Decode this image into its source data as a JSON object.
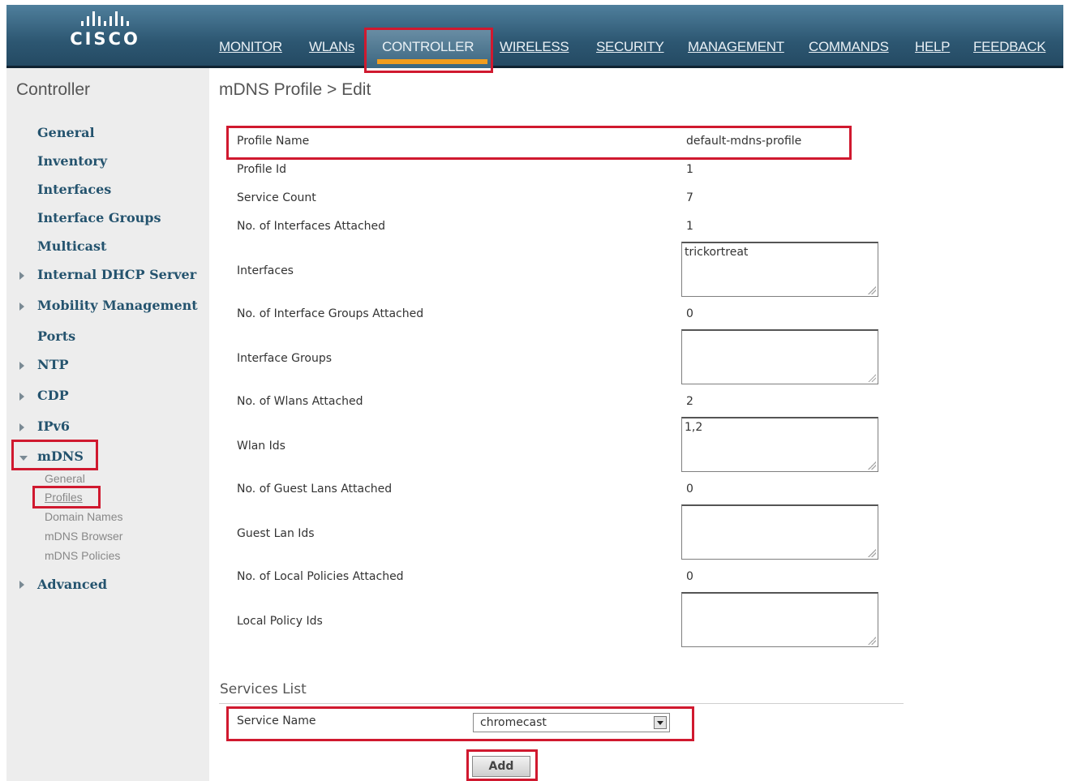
{
  "brand": {
    "logo_text": "CISCO"
  },
  "nav": {
    "items": [
      "MONITOR",
      "WLANs",
      "CONTROLLER",
      "WIRELESS",
      "SECURITY",
      "MANAGEMENT",
      "COMMANDS",
      "HELP",
      "FEEDBACK"
    ],
    "active": "CONTROLLER"
  },
  "sidebar": {
    "title": "Controller",
    "items": [
      {
        "label": "General"
      },
      {
        "label": "Inventory"
      },
      {
        "label": "Interfaces"
      },
      {
        "label": "Interface Groups"
      },
      {
        "label": "Multicast"
      },
      {
        "label": "Internal DHCP Server",
        "expandable": true
      },
      {
        "label": "Mobility Management",
        "expandable": true
      },
      {
        "label": "Ports"
      },
      {
        "label": "NTP",
        "expandable": true
      },
      {
        "label": "CDP",
        "expandable": true
      },
      {
        "label": "IPv6",
        "expandable": true
      },
      {
        "label": "mDNS",
        "expandable": true,
        "expanded": true
      },
      {
        "label": "Advanced",
        "expandable": true
      }
    ],
    "mdns_sub": [
      "General",
      "Profiles",
      "Domain Names",
      "mDNS Browser",
      "mDNS Policies"
    ],
    "mdns_selected": "Profiles"
  },
  "main": {
    "title": "mDNS Profile > Edit",
    "fields": [
      {
        "label": "Profile Name",
        "value": "default-mdns-profile"
      },
      {
        "label": "Profile Id",
        "value": "1"
      },
      {
        "label": "Service Count",
        "value": "7"
      },
      {
        "label": "No. of Interfaces Attached",
        "value": "1"
      },
      {
        "label": "Interfaces",
        "value": "trickortreat"
      },
      {
        "label": "No. of Interface Groups Attached",
        "value": "0"
      },
      {
        "label": "Interface Groups",
        "value": ""
      },
      {
        "label": "No. of Wlans Attached",
        "value": "2"
      },
      {
        "label": "Wlan Ids",
        "value": "1,2"
      },
      {
        "label": "No. of Guest Lans Attached",
        "value": "0"
      },
      {
        "label": "Guest Lan Ids",
        "value": ""
      },
      {
        "label": "No. of Local Policies Attached",
        "value": "0"
      },
      {
        "label": "Local Policy Ids",
        "value": ""
      }
    ],
    "services": {
      "heading": "Services List",
      "service_label": "Service Name",
      "service_selected": "chromecast",
      "add_label": "Add"
    }
  },
  "colors": {
    "highlight": "#d0192f",
    "nav_active_underline": "#f29d1e",
    "sidebar_link": "#24536e",
    "header_bg": "#2d5772"
  }
}
